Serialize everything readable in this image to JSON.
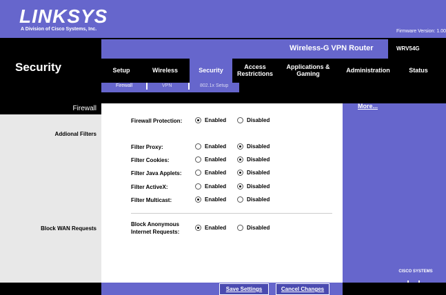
{
  "header": {
    "logo": "LINKSYS",
    "tagline": "A Division of Cisco Systems, Inc.",
    "firmware_version": "Firmware Version: 1.00"
  },
  "product": {
    "name": "Wireless-G VPN Router",
    "model": "WRV54G"
  },
  "section_title": "Security",
  "tabs": [
    {
      "label": "Setup"
    },
    {
      "label": "Wireless"
    },
    {
      "label": "Security",
      "active": true
    },
    {
      "label": "Access\nRestrictions"
    },
    {
      "label": "Applications &\nGaming"
    },
    {
      "label": "Administration"
    },
    {
      "label": "Status"
    }
  ],
  "subtabs": [
    {
      "label": "Firewall",
      "active": true
    },
    {
      "label": "VPN"
    },
    {
      "label": "802.1x Setup"
    }
  ],
  "left": {
    "firewall_heading": "Firewall",
    "additional_filters": "Addional Filters",
    "block_wan": "Block WAN Requests"
  },
  "rows": [
    {
      "label": "Firewall Protection:",
      "enabled": true
    },
    {
      "label": "Filter Proxy:",
      "enabled": false
    },
    {
      "label": "Filter Cookies:",
      "enabled": false
    },
    {
      "label": "Filter Java Applets:",
      "enabled": false
    },
    {
      "label": "Filter ActiveX:",
      "enabled": false
    },
    {
      "label": "Filter Multicast:",
      "enabled": true
    },
    {
      "label": "Block Anonymous\nInternet Requests:",
      "enabled": true
    }
  ],
  "options": {
    "enabled": "Enabled",
    "disabled": "Disabled"
  },
  "right": {
    "more_link": "More...",
    "brand": "CISCO SYSTEMS"
  },
  "buttons": {
    "save": "Save Settings",
    "cancel": "Cancel Changes"
  },
  "colors": {
    "accent": "#6666cc",
    "dark": "#000000",
    "panel": "#e8e8e8"
  }
}
